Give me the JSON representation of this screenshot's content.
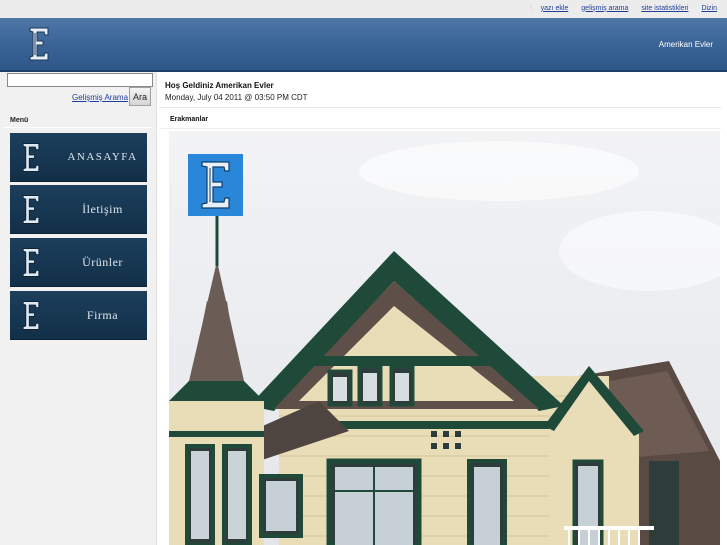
{
  "topbar": {
    "links": [
      "yazı ekle",
      "gelişmiş arama",
      "site istatistikleri",
      "Dizin"
    ]
  },
  "header": {
    "site_title": "Amerikan Evler"
  },
  "search": {
    "value": "",
    "placeholder": "",
    "advanced_label": "Gelişmiş Arama",
    "button_label": "Ara"
  },
  "menu": {
    "title": "Menü",
    "items": [
      {
        "label": "ANASAYFA"
      },
      {
        "label": "İletişim"
      },
      {
        "label": "Ürünler"
      },
      {
        "label": "Firma"
      }
    ]
  },
  "main": {
    "welcome": "Hoş Geldiniz Amerikan Evler",
    "date": "Monday, July 04 2011 @ 03:50 PM CDT",
    "section_title": "Erakmanlar"
  },
  "colors": {
    "header_blue": "#3c6698",
    "menu_navy": "#1c3f5c",
    "link_blue": "#1f3f9a",
    "logo_blue": "#2a86d8"
  },
  "icons": {
    "logo": "letter-e-logo-icon",
    "photo_logo": "letter-e-blue-tile-icon"
  }
}
